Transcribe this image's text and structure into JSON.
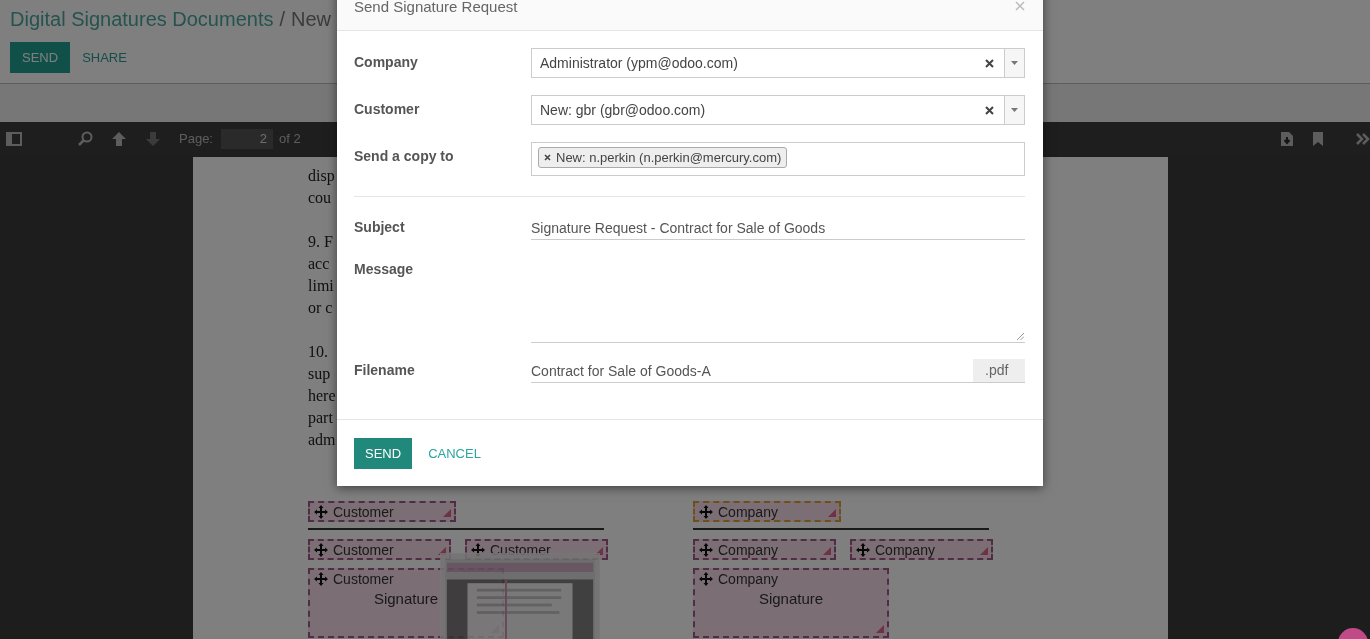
{
  "breadcrumb": {
    "parent": "Digital Signatures Documents",
    "separator": "/",
    "current": "New"
  },
  "header_buttons": [
    {
      "label": "SEND",
      "kind": "primary"
    },
    {
      "label": "SHARE",
      "kind": "link"
    }
  ],
  "pdf_toolbar": {
    "page_label": "Page:",
    "page_value": "2",
    "page_total": "of 2"
  },
  "document_paragraphs": [
    [
      "disp",
      "cou"
    ],
    [
      "9. F",
      "acc",
      "limi",
      "or c"
    ],
    [
      "10.",
      "sup",
      "here",
      "part",
      "adm"
    ]
  ],
  "signature_columns": [
    {
      "rows": [
        [
          {
            "label": "Customer",
            "kind": "field",
            "highlighted": false
          }
        ],
        [
          {
            "label": "Customer",
            "kind": "field",
            "highlighted": false
          },
          {
            "label": "Customer",
            "kind": "field",
            "highlighted": false
          }
        ],
        [
          {
            "label": "Customer",
            "kind": "signature",
            "caption": "Signature",
            "highlighted": false
          }
        ]
      ]
    },
    {
      "rows": [
        [
          {
            "label": "Company",
            "kind": "field",
            "highlighted": true
          }
        ],
        [
          {
            "label": "Company",
            "kind": "field",
            "highlighted": false
          },
          {
            "label": "Company",
            "kind": "field",
            "highlighted": false
          }
        ],
        [
          {
            "label": "Company",
            "kind": "signature",
            "caption": "Signature",
            "highlighted": false
          }
        ]
      ]
    }
  ],
  "dialog": {
    "title": "Send Signature Request",
    "fields": [
      {
        "label": "Company",
        "kind": "select",
        "value": "Administrator (ypm@odoo.com)"
      },
      {
        "label": "Customer",
        "kind": "select",
        "value": "New: gbr (gbr@odoo.com)"
      },
      {
        "label": "Send a copy to",
        "kind": "tags",
        "tags": [
          "New: n.perkin (n.perkin@mercury.com)"
        ]
      },
      {
        "label": "Subject",
        "kind": "text",
        "value": "Signature Request - Contract for Sale of Goods"
      },
      {
        "label": "Message",
        "kind": "textarea"
      },
      {
        "label": "Filename",
        "kind": "filename",
        "value": "Contract for Sale of Goods-A",
        "suffix": ".pdf"
      }
    ],
    "buttons": [
      {
        "label": "SEND",
        "kind": "primary"
      },
      {
        "label": "CANCEL",
        "kind": "link"
      }
    ]
  }
}
